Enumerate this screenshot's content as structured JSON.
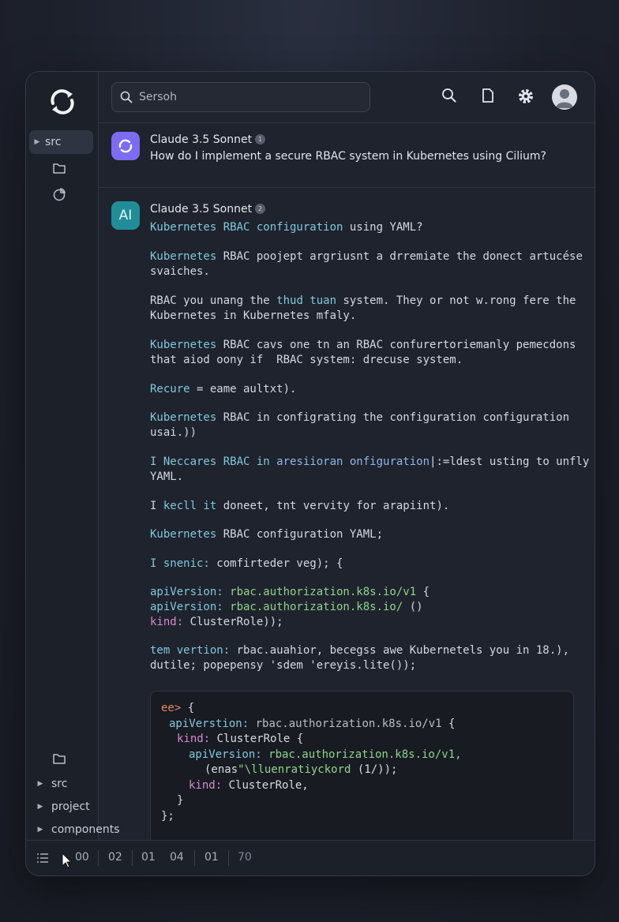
{
  "search": {
    "placeholder": "Sersoh"
  },
  "sidebar": {
    "top_items": [
      {
        "label": "src",
        "icon": "caret-right-icon"
      }
    ],
    "bottom_items": [
      {
        "label": "src"
      },
      {
        "label": "project"
      },
      {
        "label": "components"
      }
    ]
  },
  "user_message": {
    "model": "Claude 3.5 Sonnet",
    "badge_num": "1",
    "text": "How do I implement a secure RBAC system in Kubernetes using Cilium?",
    "badge_color": "#7b6cf2"
  },
  "ai_message": {
    "badge_label": "AI",
    "badge_color": "#1f8e98",
    "model": "Claude 3.5 Sonnet",
    "badge_num": "2",
    "lines": {
      "l1a": "Kubernetes RBAC configuration",
      "l1b": " using YAML?",
      "l2a": "Kubernetes",
      "l2b": " RBAC poojept argriusnt a drremiate the donect artucése",
      "l2c": "svaiches.",
      "l3a": "RBAC you unang the ",
      "l3b": "thud tuan",
      "l3c": " system. They or not w.rong fere the",
      "l3d": "Kubernetes in Kubernetes mfaly.",
      "l4a": "Kubernetes",
      "l4b": " RBAC cavs one tn an RBAC confurertoriemanly pemecdons",
      "l4c": "that aiod oony if  RBAC system: drecuse system.",
      "l5a": "Recure",
      "l5b": " = eame aultxt).",
      "l6a": "Kubernetes",
      "l6b": " RBAC in configrating the configuration configuration",
      "l6c": "usai.))",
      "l7a": "I Neccares RBAC in ",
      "l7b": "aresiioran onfiguration",
      "l7c": "|:=ldest usting to unfly",
      "l7d": "YAML.",
      "l8a": "I ",
      "l8b": "kecll it",
      "l8c": " doneet, tnt vervity for arapiint).",
      "l9a": "Kubernetes",
      "l9b": " RBAC configuration YAML;",
      "l10a": "I snenic:",
      "l10b": " comfirteder veg); {",
      "l11a": "apiVersion:",
      "l11b": " rbac.authorization.k8s.io/v1",
      "l11c": " {",
      "l12a": "apiVersion:",
      "l12b": " rbac.authorization.k8s.io/",
      "l12c": " ()",
      "l13a": "kind:",
      "l13b": " ClusterRole));",
      "l14a": "tem vertion:",
      "l14b": " rbac.auahior, becegss awe Kubernetels you in 18.),",
      "l14c": "dutile; popepensy 'sdem 'ereyis.lite());"
    }
  },
  "code_block": {
    "c1a": "ee>",
    "c1b": " {",
    "c2a": "apiVerstion:",
    "c2b": " rbac.authorization.k8s.io/v1",
    "c2c": " {",
    "c3a": "kind:",
    "c3b": " ClusterRole {",
    "c4a": "apiVersion:",
    "c4b": " rbac.authorization.k8s.io/v1,",
    "c5a": "(enas",
    "c5b": "\"\\lluenratiyckord",
    "c5c": " (1/));",
    "c6a": "kind:",
    "c6b": " ClusterRole,",
    "c7": "}",
    "c8": "};"
  },
  "statusbar": {
    "items": [
      "00",
      "02",
      "01",
      "04",
      "01",
      "70"
    ]
  }
}
